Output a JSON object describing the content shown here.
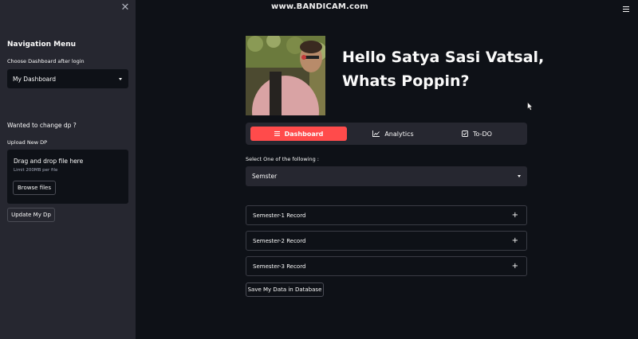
{
  "sidebar": {
    "close_icon": "close-icon",
    "title": "Navigation Menu",
    "dashboard_label": "Choose Dashboard after login",
    "dashboard_value": "My Dashboard",
    "change_dp_heading": "Wanted to change dp ?",
    "upload_label": "Upload New DP",
    "dropzone_title": "Drag and drop file here",
    "dropzone_limit": "Limit 200MB per file",
    "browse_label": "Browse files",
    "update_label": "Update My Dp"
  },
  "watermark": "www.BANDICAM.com",
  "header": {
    "greeting_line1": "Hello Satya Sasi Vatsal,",
    "greeting_line2": "Whats Poppin?"
  },
  "tabs": [
    {
      "label": "Dashboard",
      "icon": "list-icon",
      "active": true
    },
    {
      "label": "Analytics",
      "icon": "chart-line-icon",
      "active": false
    },
    {
      "label": "To-DO",
      "icon": "checkbox-icon",
      "active": false
    }
  ],
  "select": {
    "label": "Select One of the following :",
    "value": "Semster"
  },
  "expanders": [
    {
      "label": "Semester-1 Record"
    },
    {
      "label": "Semester-2 Record"
    },
    {
      "label": "Semester-3 Record"
    }
  ],
  "save_label": "Save My Data in Database",
  "colors": {
    "background": "#0e1117",
    "sidebar": "#262730",
    "accent": "#ff4b4b"
  }
}
